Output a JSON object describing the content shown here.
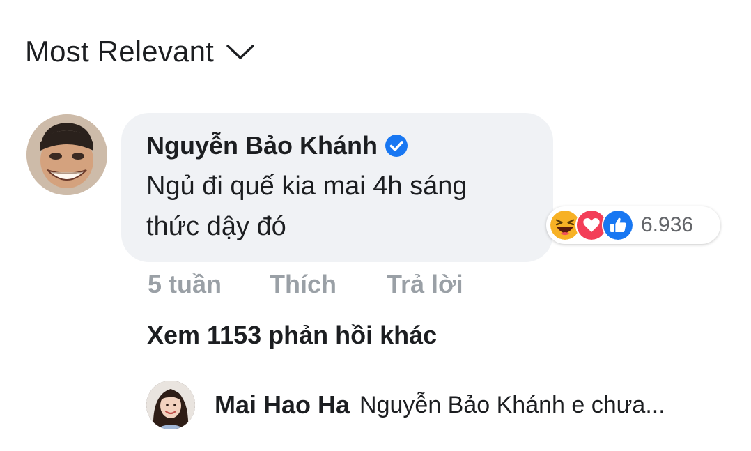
{
  "sort": {
    "label": "Most Relevant",
    "icon": "chevron-down-icon"
  },
  "comment": {
    "author": "Nguyễn Bảo Khánh",
    "verified": true,
    "text": "Ngủ đi quế kia mai 4h sáng thức dậy đó",
    "time": "5 tuần",
    "like_label": "Thích",
    "reply_label": "Trả lời",
    "reactions": {
      "icons": [
        "haha-reaction-icon",
        "love-reaction-icon",
        "like-reaction-icon"
      ],
      "count": "6.936"
    },
    "view_more_replies": "Xem 1153 phản hồi khác"
  },
  "reply_preview": {
    "author": "Mai Hao Ha",
    "text": "Nguyễn Bảo Khánh  e chưa..."
  },
  "colors": {
    "bubble_bg": "#f0f2f5",
    "verified_blue": "#1877f2",
    "muted_text": "#9aa0a6",
    "haha_yellow": "#f7b125",
    "love_red": "#f33e58",
    "like_blue": "#1877f2"
  }
}
